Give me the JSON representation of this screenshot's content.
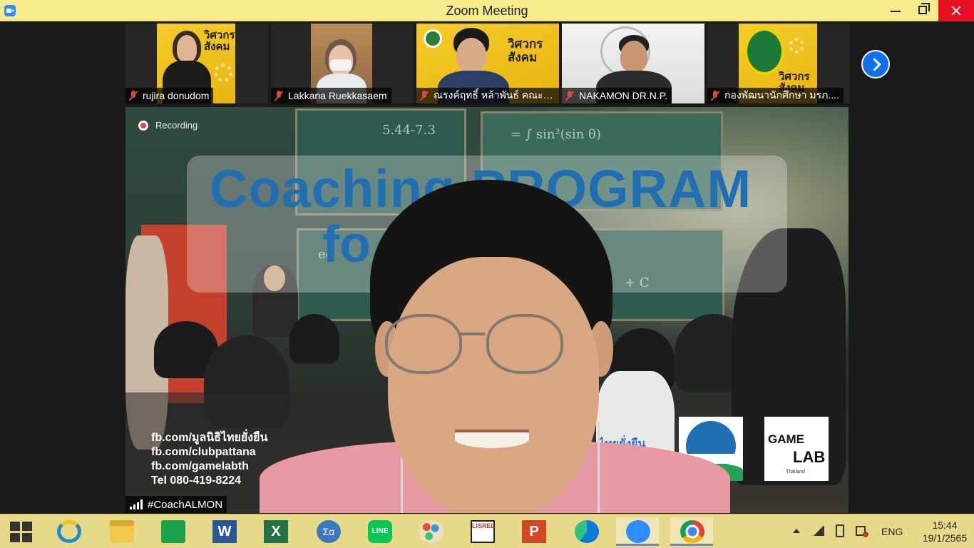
{
  "window": {
    "title": "Zoom Meeting"
  },
  "gallery": {
    "participants": [
      {
        "name": "rujira donudom",
        "muted": true,
        "poster_text": "วิศวกร สังคม"
      },
      {
        "name": "Lakkana Ruekkasaem",
        "muted": true
      },
      {
        "name": "ณรงค์ฤทธิ์ หล้าพันธ์ คณะว...",
        "muted": true,
        "poster_text": "วิศวกร สังคม"
      },
      {
        "name": "NAKAMON DR.N.P.",
        "muted": true
      },
      {
        "name": "กองพัฒนานักศึกษา มรภ....",
        "muted": true,
        "poster_text": "วิศวกร สังคม"
      }
    ]
  },
  "main_video": {
    "recording_label": "Recording",
    "speaker_name": "#CoachALMON",
    "background_title_line1": "Coaching PROGRAM",
    "background_title_line2": "fo          er",
    "contacts": [
      "fb.com/มูลนิธิไทยยั่งยืน",
      "fb.com/clubpattana",
      "fb.com/gamelabth",
      "Tel 080-419-8224"
    ],
    "logos": {
      "thaiyangyuen": "ไทยยั่งยืน",
      "gamelab_line1": "GAME",
      "gamelab_line2": "LAB",
      "gamelab_sub": "Thailand"
    },
    "chalk_texts": [
      "5.44-7.3",
      "= ∫ sin²(sin θ)",
      "eq",
      "+ C"
    ]
  },
  "taskbar": {
    "apps": [
      {
        "name": "Start"
      },
      {
        "name": "Internet Explorer"
      },
      {
        "name": "File Explorer"
      },
      {
        "name": "Store"
      },
      {
        "name": "Word",
        "glyph": "W"
      },
      {
        "name": "Excel",
        "glyph": "X"
      },
      {
        "name": "Math Input",
        "glyph": "Σα"
      },
      {
        "name": "LINE",
        "glyph": "LINE"
      },
      {
        "name": "Paint"
      },
      {
        "name": "LISREL",
        "glyph": "LISREL"
      },
      {
        "name": "PowerPoint",
        "glyph": "P"
      },
      {
        "name": "Edge"
      },
      {
        "name": "Zoom"
      },
      {
        "name": "Chrome"
      }
    ],
    "tray": {
      "language": "ENG",
      "time": "15:44",
      "date": "19/1/2565"
    }
  },
  "colors": {
    "titlebar": "#f6ec8c",
    "taskbar": "#e7d98a",
    "zoom_blue": "#0e71eb",
    "close_red": "#e81123",
    "muted_red": "#e0443e",
    "banner_blue": "#1f6fb2"
  }
}
